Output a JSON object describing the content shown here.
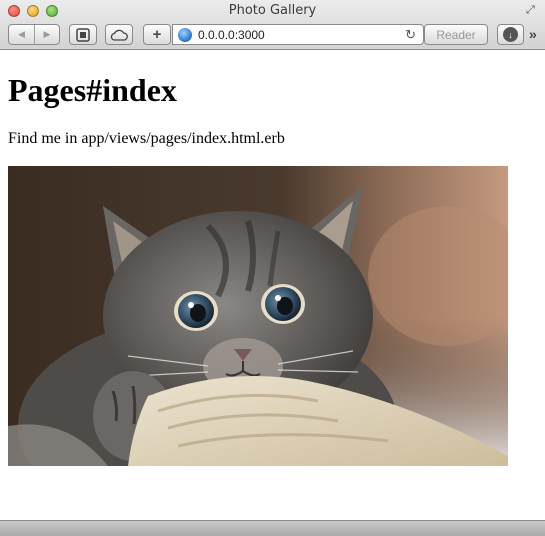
{
  "window": {
    "title": "Photo Gallery"
  },
  "toolbar": {
    "back_icon": "back-arrow-icon",
    "forward_icon": "forward-arrow-icon",
    "address_value": "0.0.0.0:3000",
    "reader_label": "Reader"
  },
  "page": {
    "heading": "Pages#index",
    "text": "Find me in app/views/pages/index.html.erb"
  },
  "colors": {
    "accent_globe": "#2a6fc9",
    "close": "#e0443e",
    "minimize": "#dea123",
    "maximize": "#4fa93a"
  }
}
